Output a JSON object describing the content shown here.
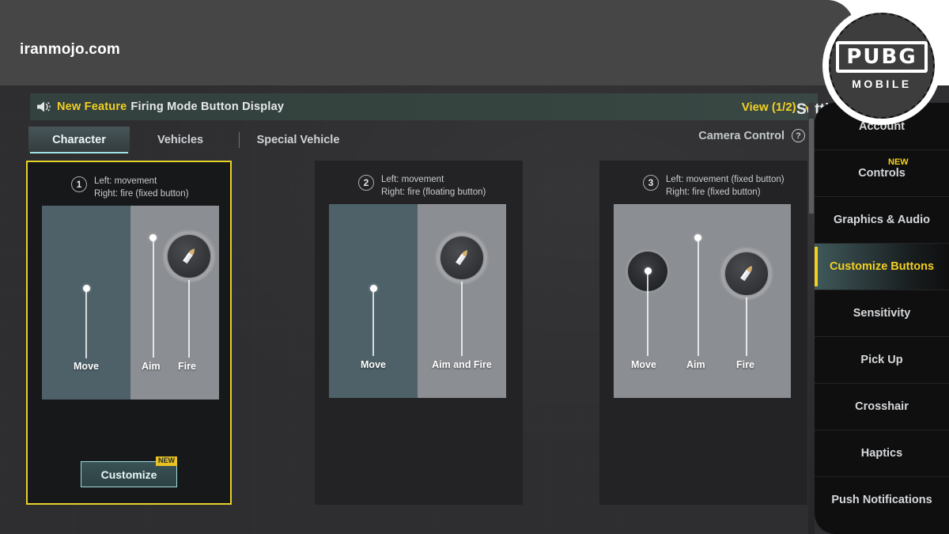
{
  "watermark": {
    "text": "iranmojo.com"
  },
  "logo": {
    "word": "PUBG",
    "sub": "MOBILE",
    "icon": "pubg-mobile-logo"
  },
  "announcement": {
    "icon": "speaker-icon",
    "new_label": "New Feature",
    "message": "Firing Mode Button Display",
    "view_label": "View (1/2)",
    "chevron": "›"
  },
  "tabs": [
    {
      "label": "Character",
      "active": true
    },
    {
      "label": "Vehicles",
      "active": false
    },
    {
      "label": "Special Vehicle",
      "active": false
    }
  ],
  "camera_control": {
    "label": "Camera Control",
    "help": "?"
  },
  "cards": [
    {
      "number": "1",
      "desc_line1": "Left: movement",
      "desc_line2": "Right: fire (fixed button)",
      "selected": true,
      "layout": "split",
      "labels": {
        "move": "Move",
        "aim": "Aim",
        "fire": "Fire"
      },
      "customize": {
        "label": "Customize",
        "tag": "NEW"
      }
    },
    {
      "number": "2",
      "desc_line1": "Left: movement",
      "desc_line2": "Right: fire (floating button)",
      "selected": false,
      "layout": "split-merged",
      "labels": {
        "move": "Move",
        "aimfire": "Aim and Fire"
      }
    },
    {
      "number": "3",
      "desc_line1": "Left: movement (fixed button)",
      "desc_line2": "Right: fire (fixed button)",
      "selected": false,
      "layout": "full",
      "labels": {
        "move": "Move",
        "aim": "Aim",
        "fire": "Fire"
      }
    }
  ],
  "sidebar": {
    "title": "Settings",
    "items": [
      {
        "label": "Account",
        "active": false,
        "badge": ""
      },
      {
        "label": "Controls",
        "active": false,
        "badge": "NEW"
      },
      {
        "label": "Graphics & Audio",
        "active": false,
        "badge": ""
      },
      {
        "label": "Customize Buttons",
        "active": true,
        "badge": ""
      },
      {
        "label": "Sensitivity",
        "active": false,
        "badge": ""
      },
      {
        "label": "Pick Up",
        "active": false,
        "badge": ""
      },
      {
        "label": "Crosshair",
        "active": false,
        "badge": ""
      },
      {
        "label": "Haptics",
        "active": false,
        "badge": ""
      },
      {
        "label": "Push Notifications",
        "active": false,
        "badge": ""
      }
    ]
  },
  "colors": {
    "accent_yellow": "#f2d022",
    "accent_cyan": "#9fe3e6",
    "move_pane": "#4e6169",
    "fire_pane": "#8b8e92",
    "background": "#2e2e30",
    "sidebar_bg": "#0f0f10"
  }
}
